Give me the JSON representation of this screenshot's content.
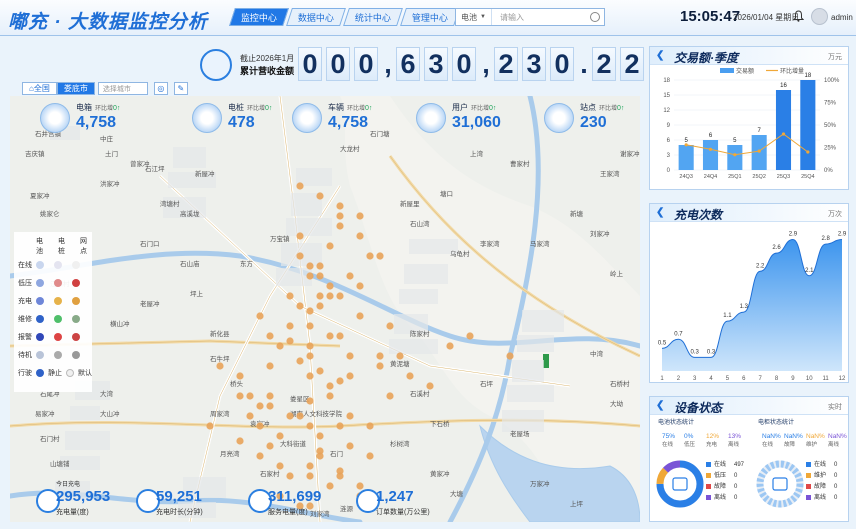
{
  "header": {
    "title": "嘟充 · 大数据监控分析",
    "tabs": [
      {
        "label": "监控中心",
        "active": true
      },
      {
        "label": "数据中心",
        "active": false
      },
      {
        "label": "统计中心",
        "active": false
      },
      {
        "label": "管理中心",
        "active": false
      }
    ],
    "search": {
      "selected": "电池",
      "placeholder": "请输入"
    },
    "clock": "15:05:47",
    "date": "2026/01/04 星期日",
    "user": "admin"
  },
  "revenue": {
    "label_top": "截止2026年1月",
    "label_bottom": "累计营收金额",
    "digits": [
      "0",
      "0",
      "0",
      ",",
      "6",
      "3",
      "0",
      ",",
      "2",
      "3",
      "0",
      ".",
      "2",
      "2"
    ],
    "unit": "元"
  },
  "map_tabs": {
    "items": [
      {
        "label": "全国",
        "active": false
      },
      {
        "label": "娄底市",
        "active": true
      }
    ],
    "select_placeholder": "选择城市"
  },
  "top_stats": [
    {
      "name": "电箱",
      "sub": "环比增",
      "delta": "0↑",
      "value": "4,758"
    },
    {
      "name": "电桩",
      "sub": "环比增",
      "delta": "0↑",
      "value": "478"
    },
    {
      "name": "车辆",
      "sub": "环比增",
      "delta": "0↑",
      "value": "4,758"
    },
    {
      "name": "用户",
      "sub": "环比增",
      "delta": "0↑",
      "value": "31,060"
    },
    {
      "name": "站点",
      "sub": "环比增",
      "delta": "0↑",
      "value": "230"
    }
  ],
  "map_labels": [
    "吉庆镇",
    "石井宫镇",
    "中庄",
    "土门",
    "曾家冲",
    "石江坪",
    "高溪垅",
    "夏家冲",
    "姚家仑",
    "洪家冲",
    "湾塘村",
    "新屋冲",
    "石门口",
    "石山庙",
    "江口村",
    "石尾冲",
    "易家冲",
    "石门村",
    "山塘铺",
    "大湾",
    "大山冲",
    "横山冲",
    "老屋冲",
    "坪上",
    "石牛坪",
    "桥头",
    "周家湾",
    "袁家冲",
    "月亮湾",
    "石家村",
    "湖南人文科技学院",
    "娄星区",
    "大科街道",
    "新化县",
    "万宝镇",
    "东方",
    "石门",
    "涟源",
    "双峰",
    "刘家湾",
    "陈家村",
    "黄泥塘",
    "石溪村",
    "下石桥",
    "杉树湾",
    "黄家冲",
    "大塘",
    "石坪",
    "老屋场",
    "万家冲",
    "上坪",
    "中湾",
    "石桥村",
    "大坳",
    "新塘",
    "刘家冲",
    "马家湾",
    "李家湾",
    "乌龟村",
    "塘口",
    "新屋里",
    "石山湾",
    "岭上",
    "王家湾",
    "谢家冲",
    "曹家村",
    "上湾",
    "石门塘",
    "大龙村"
  ],
  "legend": {
    "headers": [
      "电池",
      "电桩",
      "网点"
    ],
    "rows": [
      "在线",
      "低压",
      "充电",
      "维修",
      "报警",
      "待机"
    ],
    "footer": [
      "行驶",
      "静止",
      "默认"
    ]
  },
  "bottom_stats": [
    {
      "top": "今日充电",
      "value": "295,953",
      "label": "充电量(度)"
    },
    {
      "top": "",
      "value": "59,251",
      "label": "充电时长(分钟)"
    },
    {
      "top": "",
      "value": "311,699",
      "label": "服务电量(度)"
    },
    {
      "top": "",
      "value": "1,247",
      "label": "订单数量(万公里)"
    }
  ],
  "panel_trans": {
    "title": "交易额·季度",
    "right": "万元"
  },
  "panel_charge": {
    "title": "充电次数",
    "right": "万次"
  },
  "panel_device": {
    "title": "设备状态",
    "right": "实时"
  },
  "chart_data": [
    {
      "type": "bar",
      "title": "交易额·季度",
      "categories": [
        "24Q3",
        "24Q4",
        "25Q1",
        "25Q2",
        "25Q3",
        "25Q4"
      ],
      "series": [
        {
          "name": "交易额",
          "values": [
            5,
            6,
            5,
            7,
            16,
            18
          ]
        },
        {
          "name": "环比增量",
          "values": [
            28,
            23,
            17,
            21,
            40,
            20
          ]
        }
      ],
      "ylim": [
        0,
        18
      ],
      "y2lim": [
        0,
        100
      ],
      "y_ticks": [
        0,
        3,
        6,
        9,
        12,
        15,
        18
      ],
      "y2_ticks": [
        "0%",
        "25%",
        "50%",
        "75%",
        "100%"
      ]
    },
    {
      "type": "area",
      "title": "充电次数",
      "x": [
        1,
        2,
        3,
        4,
        5,
        6,
        7,
        8,
        9,
        10,
        11,
        12
      ],
      "values": [
        0.5,
        0.7,
        0.3,
        0.3,
        1.1,
        1.3,
        2.2,
        2.6,
        2.9,
        2.1,
        2.8,
        2.9
      ],
      "ylim": [
        0,
        3
      ]
    }
  ],
  "device_status": {
    "left": {
      "title": "电池状态统计",
      "tops": [
        {
          "v": "75%",
          "l": "在线"
        },
        {
          "v": "0%",
          "l": "低压"
        },
        {
          "v": "12%",
          "l": "充电"
        },
        {
          "v": "13%",
          "l": "离线"
        }
      ],
      "items": [
        {
          "l": "在线",
          "v": "497"
        },
        {
          "l": "低压",
          "v": "0"
        },
        {
          "l": "故障",
          "v": "0"
        },
        {
          "l": "离线",
          "v": "0"
        }
      ]
    },
    "right": {
      "title": "电柜状态统计",
      "tops": [
        {
          "v": "NaN%",
          "l": "在线"
        },
        {
          "v": "NaN%",
          "l": "故障"
        },
        {
          "v": "NaN%",
          "l": "维护"
        },
        {
          "v": "NaN%",
          "l": "离线"
        }
      ],
      "items": [
        {
          "l": "在线",
          "v": "0"
        },
        {
          "l": "维护",
          "v": "0"
        },
        {
          "l": "故障",
          "v": "0"
        },
        {
          "l": "离线",
          "v": "0"
        }
      ]
    }
  },
  "colors": {
    "accent": "#2178e6",
    "dot": "#e8a35a",
    "area": "#4a9ef0"
  }
}
